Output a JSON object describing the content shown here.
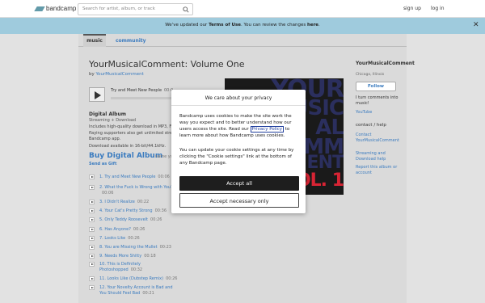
{
  "header": {
    "logo_text": "bandcamp",
    "search_placeholder": "Search for artist, album, or track",
    "signup": "sign up",
    "login": "log in"
  },
  "banner": {
    "text_before": "We've updated our",
    "terms_link": "Terms of Use",
    "text_middle": ". You can review the changes",
    "here_link": "here",
    "text_after": "."
  },
  "tabs": {
    "music": "music",
    "community": "community"
  },
  "album": {
    "title": "YourMusicalComment: Volume One",
    "by": "by",
    "artist": "YourMusicalComment",
    "now_playing": "Try and Meet New People",
    "now_time": "00:0",
    "digital_heading": "Digital Album",
    "digital_sub": "Streaming + Download",
    "description_lines": [
      "Includes high-quality download in MP3, FL",
      "flaying supporters also get unlimited strea",
      "Bandcamp app."
    ],
    "availability": "Download available in 16-bit/44.1kHz.",
    "buy_label": "Buy Digital Album",
    "buy_price": "name yo",
    "gift_label": "Send as Gift"
  },
  "tracks": [
    {
      "title": "1. Try and Meet New People",
      "duration": "00:06"
    },
    {
      "title": "2. What the Fuck is Wrong with You?",
      "duration": "00:06"
    },
    {
      "title": "3. I Didn't Realize",
      "duration": "00:22"
    },
    {
      "title": "4. Your Cat's Pretty Strong",
      "duration": "00:36"
    },
    {
      "title": "5. Only Teddy Roosevelt",
      "duration": "00:26"
    },
    {
      "title": "6. Has Anyone?",
      "duration": "00:26"
    },
    {
      "title": "7. Looks Like",
      "duration": "00:26"
    },
    {
      "title": "8. You are Missing the Mullet",
      "duration": "00:23"
    },
    {
      "title": "9. Needs More Shitty",
      "duration": "00:18"
    },
    {
      "title": "10. This is Definitely Photoshopped",
      "duration": "00:32"
    },
    {
      "title": "11. Looks Like (Dubstep Remix)",
      "duration": "00:26"
    },
    {
      "title": "12. Your Novelty Account is Bad and You Should Feel Bad",
      "duration": "00:21"
    }
  ],
  "artwork": {
    "lines": [
      "YOUR",
      "MUSIC",
      "AL",
      "COMM",
      "ENT",
      "VOL. 1"
    ]
  },
  "sidebar": {
    "band_name": "YourMusicalComment",
    "location": "Chicago, Illinois",
    "follow": "Follow",
    "bio": "I turn comments into music!",
    "youtube": "YouTube",
    "contact_heading": "contact / help",
    "contact_link": "Contact YourMusicalComment",
    "streaming_help": "Streaming and Download help",
    "report": "Report this album or account"
  },
  "modal": {
    "title": "We care about your privacy",
    "p1_before": "Bandcamp uses cookies to make the site work the way you expect and to better understand how our users access the site. Read our",
    "privacy_link": "Privacy Policy",
    "p1_after": "to learn more about how Bandcamp uses cookies.",
    "p2": "You can update your cookie settings at any time by clicking the \"Cookie settings\" link at the bottom of any Bandcamp page.",
    "accept_all": "Accept all",
    "accept_necessary": "Accept necessary only"
  }
}
